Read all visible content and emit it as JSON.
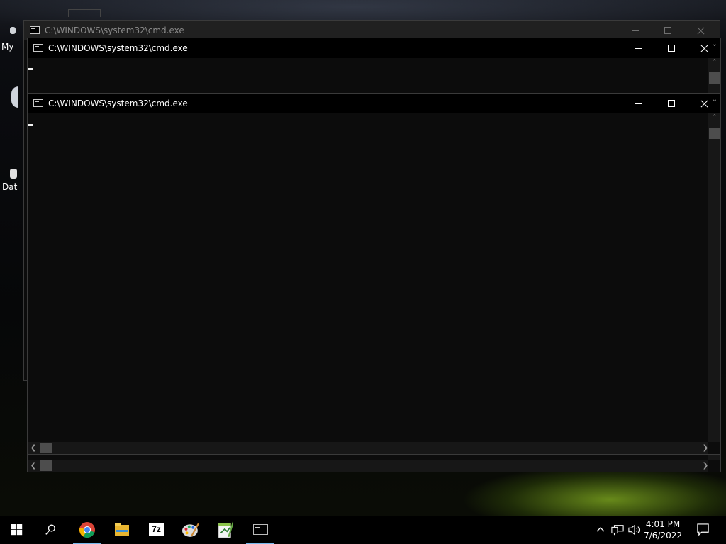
{
  "desktop": {
    "icons": [
      {
        "label": "My"
      },
      {
        "label": "Dat"
      }
    ]
  },
  "windows": [
    {
      "title": "C:\\WINDOWS\\system32\\cmd.exe",
      "state": "inactive"
    },
    {
      "title": "C:\\WINDOWS\\system32\\cmd.exe",
      "state": "active"
    },
    {
      "title": "C:\\WINDOWS\\system32\\cmd.exe",
      "state": "active"
    }
  ],
  "caption_buttons": {
    "minimize": "minimize-icon",
    "maximize": "maximize-icon",
    "close": "close-icon"
  },
  "taskbar": {
    "start": "windows-start-icon",
    "search": "search-icon",
    "apps": [
      {
        "name": "chrome-icon"
      },
      {
        "name": "file-explorer-icon"
      },
      {
        "name": "7zip-icon",
        "text": "7z"
      },
      {
        "name": "paint-palette-icon"
      },
      {
        "name": "notepad-plus-icon"
      },
      {
        "name": "cmd-icon"
      }
    ],
    "tray": {
      "chevron": "show-hidden-icons-chevron-icon",
      "network": "network-icon",
      "volume": "volume-icon",
      "time": "4:01 PM",
      "date": "7/6/2022",
      "notifications": "action-center-icon"
    }
  },
  "colors": {
    "taskbar_bg": "#000000",
    "console_bg": "#0c0c0c",
    "active_indicator": "#76b9ed"
  }
}
